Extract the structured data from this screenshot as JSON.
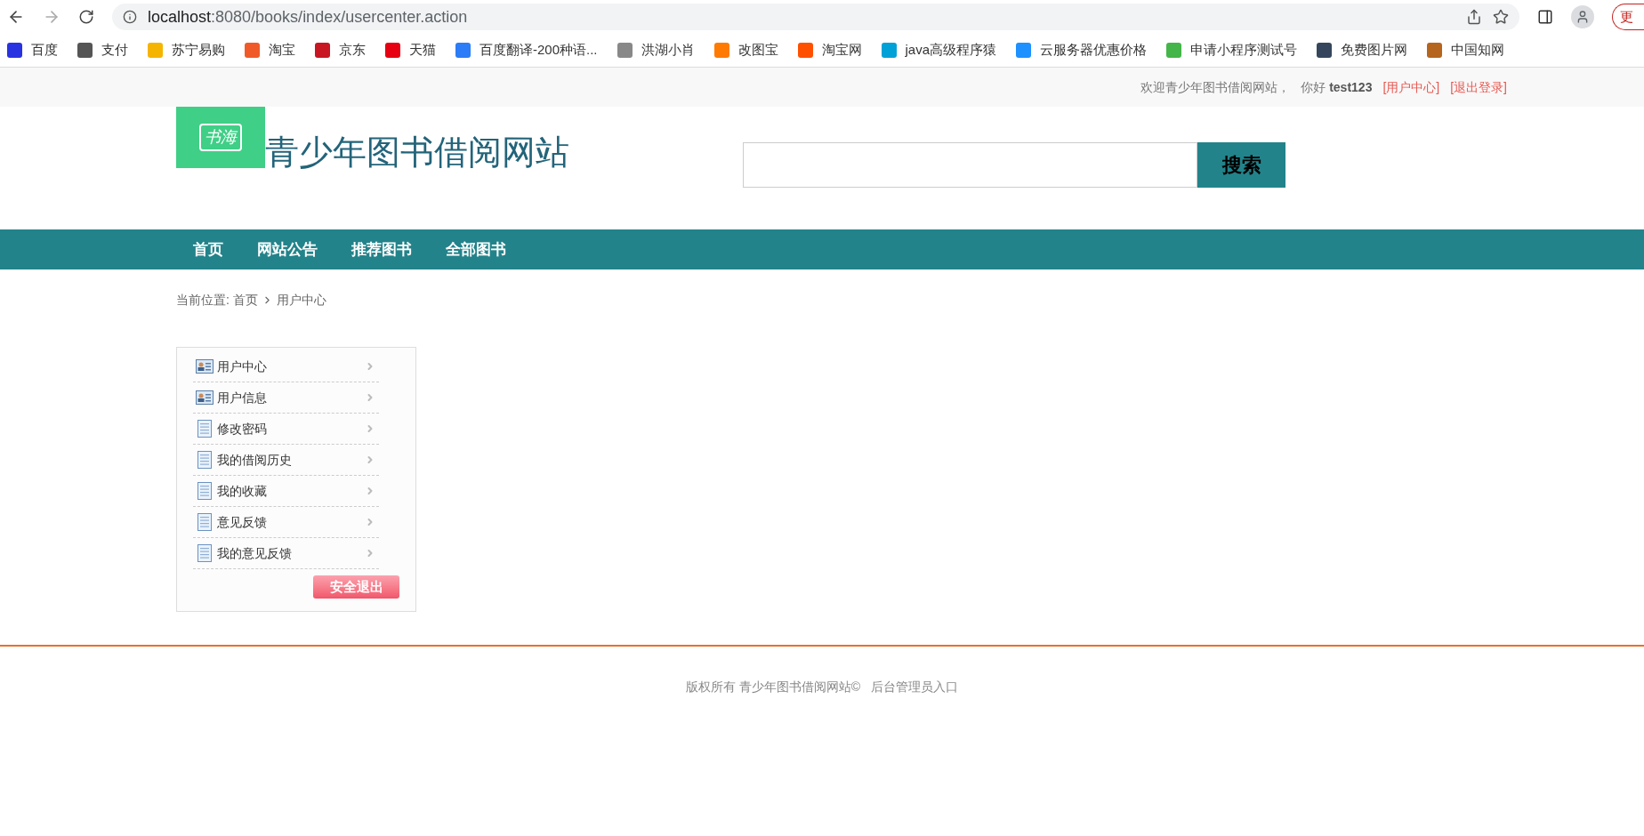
{
  "browser": {
    "url_host": "localhost",
    "url_rest": ":8080/books/index/usercenter.action",
    "update_button": "更"
  },
  "bookmarks": [
    {
      "label": "百度",
      "color": "#2932e1"
    },
    {
      "label": "支付",
      "color": "#555555"
    },
    {
      "label": "苏宁易购",
      "color": "#f5b400"
    },
    {
      "label": "淘宝",
      "color": "#f05a28"
    },
    {
      "label": "京东",
      "color": "#c81623"
    },
    {
      "label": "天猫",
      "color": "#e60012"
    },
    {
      "label": "百度翻译-200种语...",
      "color": "#2b7cf6"
    },
    {
      "label": "洪湖小肖",
      "color": "#888888"
    },
    {
      "label": "改图宝",
      "color": "#ff7a00"
    },
    {
      "label": "淘宝网",
      "color": "#ff5000"
    },
    {
      "label": "java高级程序猿",
      "color": "#00a1d6"
    },
    {
      "label": "云服务器优惠价格",
      "color": "#1e90ff"
    },
    {
      "label": "申请小程序测试号",
      "color": "#44b549"
    },
    {
      "label": "免费图片网",
      "color": "#35465c"
    },
    {
      "label": "中国知网",
      "color": "#b5651d"
    }
  ],
  "topbar": {
    "welcome": "欢迎青少年图书借阅网站，",
    "greeting": "你好",
    "username": "test123",
    "links": [
      "[用户中心]",
      "[退出登录]"
    ]
  },
  "header": {
    "logo_text": "书海",
    "site_title": "青少年图书借阅网站",
    "search_button": "搜索"
  },
  "nav": [
    "首页",
    "网站公告",
    "推荐图书",
    "全部图书"
  ],
  "breadcrumb": {
    "prefix": "当前位置:",
    "home": "首页",
    "current": "用户中心"
  },
  "sidebar": {
    "items": [
      {
        "label": "用户中心",
        "kind": "user-card"
      },
      {
        "label": "用户信息",
        "kind": "user-card"
      },
      {
        "label": "修改密码",
        "kind": "document"
      },
      {
        "label": "我的借阅历史",
        "kind": "document"
      },
      {
        "label": "我的收藏",
        "kind": "document"
      },
      {
        "label": "意见反馈",
        "kind": "document"
      },
      {
        "label": "我的意见反馈",
        "kind": "document"
      }
    ],
    "logout_button": "安全退出"
  },
  "footer": {
    "copyright": "版权所有 青少年图书借阅网站©",
    "admin_link": "后台管理员入口"
  }
}
